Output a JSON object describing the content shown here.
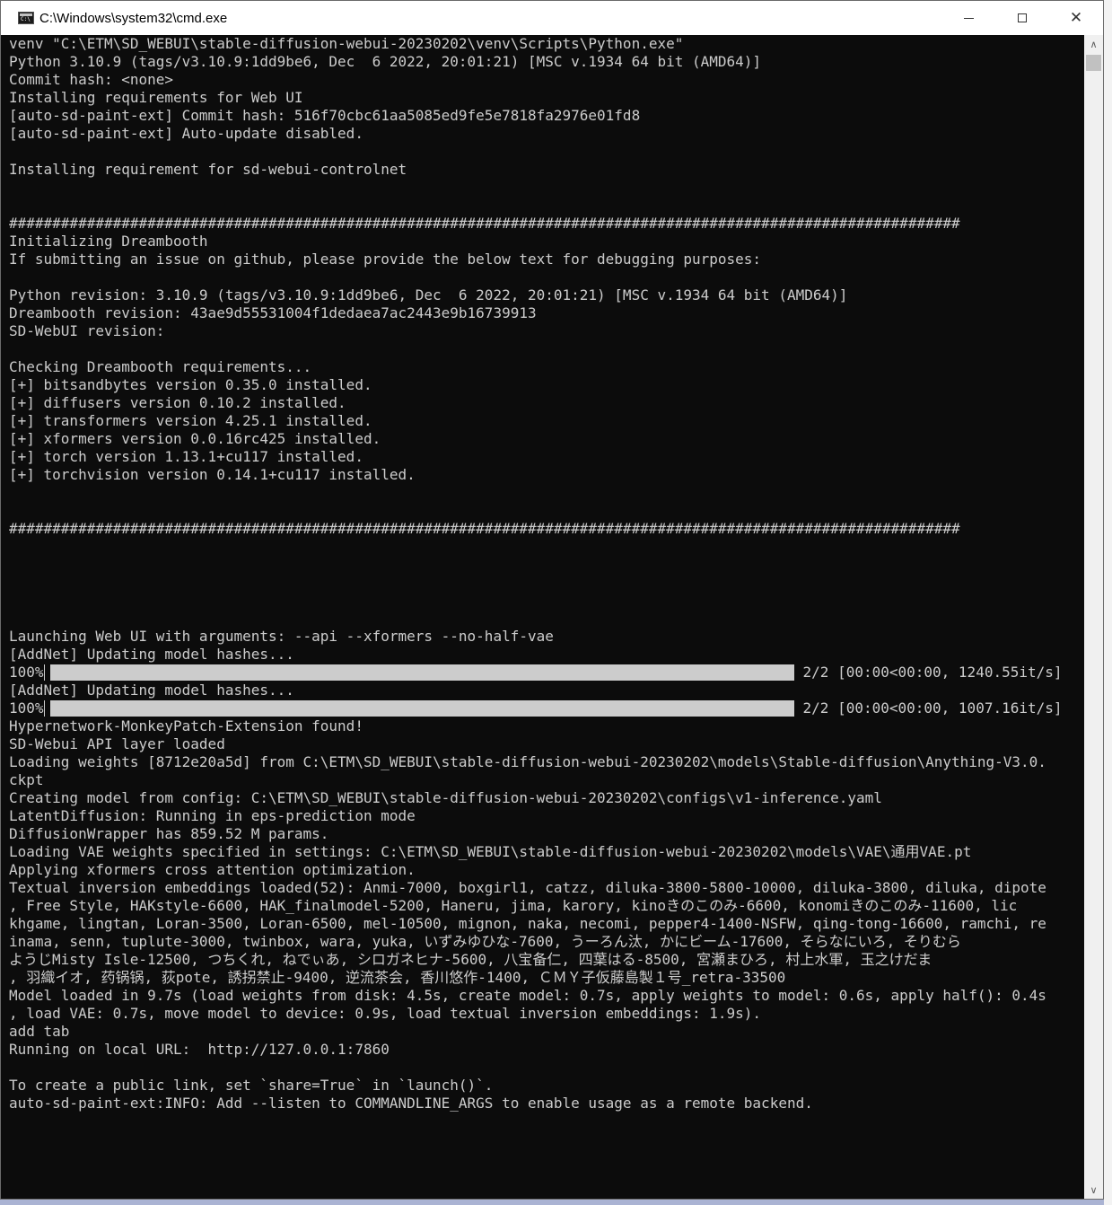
{
  "window": {
    "title": "C:\\Windows\\system32\\cmd.exe",
    "icon": "cmd-icon",
    "controls": {
      "minimize": "minimize-icon",
      "maximize": "maximize-icon",
      "close": "close-icon",
      "close_glyph": "✕"
    }
  },
  "console": {
    "lines_before_progress": [
      "venv \"C:\\ETM\\SD_WEBUI\\stable-diffusion-webui-20230202\\venv\\Scripts\\Python.exe\"",
      "Python 3.10.9 (tags/v3.10.9:1dd9be6, Dec  6 2022, 20:01:21) [MSC v.1934 64 bit (AMD64)]",
      "Commit hash: <none>",
      "Installing requirements for Web UI",
      "[auto-sd-paint-ext] Commit hash: 516f70cbc61aa5085ed9fe5e7818fa2976e01fd8",
      "[auto-sd-paint-ext] Auto-update disabled.",
      "",
      "Installing requirement for sd-webui-controlnet",
      "",
      "",
      "##############################################################################################################",
      "Initializing Dreambooth",
      "If submitting an issue on github, please provide the below text for debugging purposes:",
      "",
      "Python revision: 3.10.9 (tags/v3.10.9:1dd9be6, Dec  6 2022, 20:01:21) [MSC v.1934 64 bit (AMD64)]",
      "Dreambooth revision: 43ae9d55531004f1dedaea7ac2443e9b16739913",
      "SD-WebUI revision:",
      "",
      "Checking Dreambooth requirements...",
      "[+] bitsandbytes version 0.35.0 installed.",
      "[+] diffusers version 0.10.2 installed.",
      "[+] transformers version 4.25.1 installed.",
      "[+] xformers version 0.0.16rc425 installed.",
      "[+] torch version 1.13.1+cu117 installed.",
      "[+] torchvision version 0.14.1+cu117 installed.",
      "",
      "",
      "##############################################################################################################",
      "",
      "",
      "",
      "",
      "",
      "Launching Web UI with arguments: --api --xformers --no-half-vae",
      "[AddNet] Updating model hashes..."
    ],
    "progress1": {
      "percent": "100%",
      "fill_fraction": 1.0,
      "stats": "2/2 [00:00<00:00, 1240.55it/s]"
    },
    "line_between_progress": "[AddNet] Updating model hashes...",
    "progress2": {
      "percent": "100%",
      "fill_fraction": 1.0,
      "stats": "2/2 [00:00<00:00, 1007.16it/s]"
    },
    "lines_after_progress": [
      "Hypernetwork-MonkeyPatch-Extension found!",
      "SD-Webui API layer loaded",
      "Loading weights [8712e20a5d] from C:\\ETM\\SD_WEBUI\\stable-diffusion-webui-20230202\\models\\Stable-diffusion\\Anything-V3.0.",
      "ckpt",
      "Creating model from config: C:\\ETM\\SD_WEBUI\\stable-diffusion-webui-20230202\\configs\\v1-inference.yaml",
      "LatentDiffusion: Running in eps-prediction mode",
      "DiffusionWrapper has 859.52 M params.",
      "Loading VAE weights specified in settings: C:\\ETM\\SD_WEBUI\\stable-diffusion-webui-20230202\\models\\VAE\\通用VAE.pt",
      "Applying xformers cross attention optimization.",
      "Textual inversion embeddings loaded(52): Anmi-7000, boxgirl1, catzz, diluka-3800-5800-10000, diluka-3800, diluka, dipote",
      ", Free Style, HAKstyle-6600, HAK_finalmodel-5200, Haneru, jima, karory, kinoきのこのみ-6600, konomiきのこのみ-11600, lic",
      "khgame, lingtan, Loran-3500, Loran-6500, mel-10500, mignon, naka, necomi, pepper4-1400-NSFW, qing-tong-16600, ramchi, re",
      "inama, senn, tuplute-3000, twinbox, wara, yuka, いずみゆひな-7600, うーろん汰, かにビーム-17600, そらなにいろ, そりむら",
      "ようじMisty Isle-12500, つちくれ, ねでぃあ, シロガネヒナ-5600, 八宝备仁, 四葉はる-8500, 宮瀬まひろ, 村上水軍, 玉之けだま",
      ", 羽織イオ, 药锅锅, 荻pote, 誘拐禁止-9400, 逆流茶会, 香川悠作-1400, ＣＭＹ子仮藤島製１号_retra-33500",
      "Model loaded in 9.7s (load weights from disk: 4.5s, create model: 0.7s, apply weights to model: 0.6s, apply half(): 0.4s",
      ", load VAE: 0.7s, move model to device: 0.9s, load textual inversion embeddings: 1.9s).",
      "add tab",
      "Running on local URL:  http://127.0.0.1:7860",
      "",
      "To create a public link, set `share=True` in `launch()`.",
      "auto-sd-paint-ext:INFO: Add --listen to COMMANDLINE_ARGS to enable usage as a remote backend."
    ]
  },
  "scrollbar": {
    "up_glyph": "∧",
    "down_glyph": "∨",
    "thumb_position_fraction": 0.0
  },
  "colors": {
    "console_bg": "#0c0c0c",
    "console_fg": "#cccccc",
    "titlebar_bg": "#ffffff"
  }
}
